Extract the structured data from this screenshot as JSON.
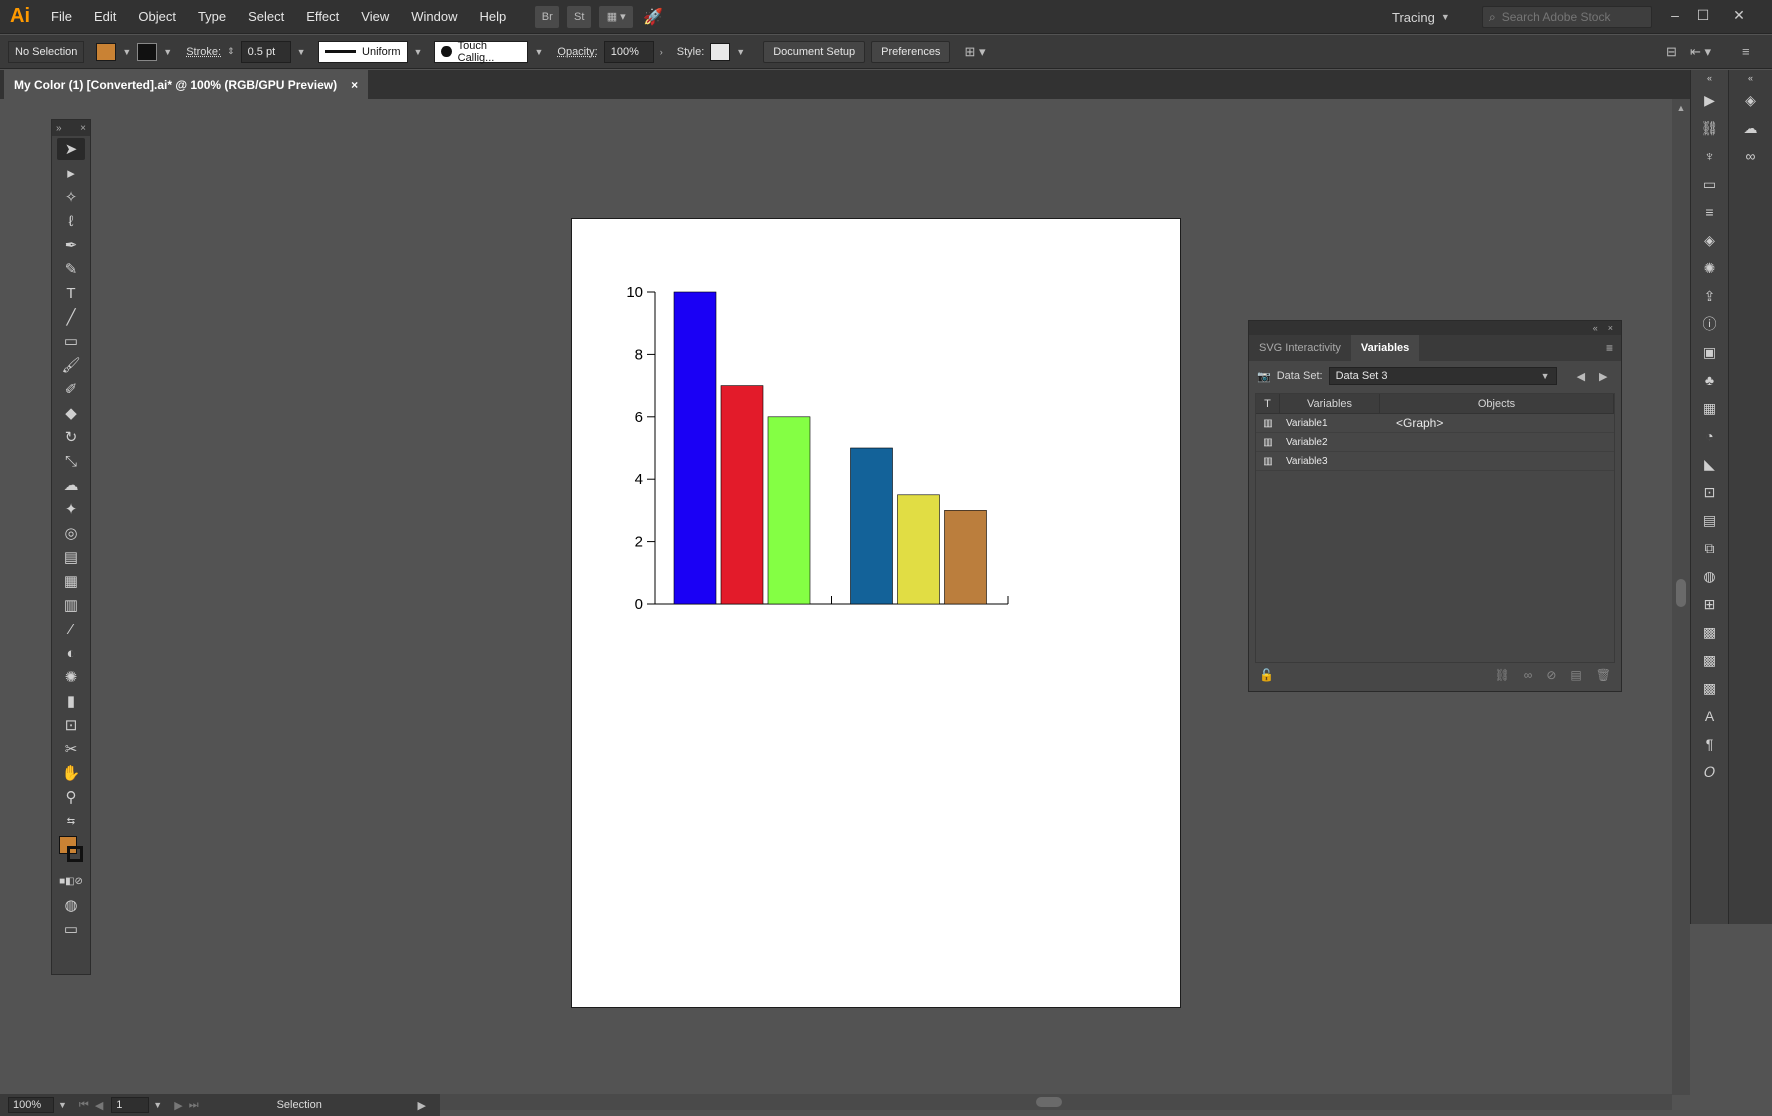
{
  "app": {
    "logo": "Ai"
  },
  "menu": [
    "File",
    "Edit",
    "Object",
    "Type",
    "Select",
    "Effect",
    "View",
    "Window",
    "Help"
  ],
  "menubar_buttons": {
    "bridge": "Br",
    "stock": "St"
  },
  "workspace": "Tracing",
  "search": {
    "placeholder": "Search Adobe Stock"
  },
  "control": {
    "selection": "No Selection",
    "fill_color": "#c98234",
    "stroke_label": "Stroke:",
    "stroke_weight": "0.5 pt",
    "stroke_profile": "Uniform",
    "brush": "Touch Callig...",
    "opacity_label": "Opacity:",
    "opacity": "100%",
    "style_label": "Style:",
    "document_setup": "Document Setup",
    "preferences": "Preferences"
  },
  "document_tab": {
    "title": "My Color (1) [Converted].ai* @ 100% (RGB/GPU Preview)",
    "close": "×"
  },
  "tools": [
    "selection-tool",
    "direct-selection-tool",
    "magic-wand-tool",
    "lasso-tool",
    "pen-tool",
    "curvature-tool",
    "type-tool",
    "line-tool",
    "rectangle-tool",
    "paintbrush-tool",
    "blob-brush-tool",
    "eraser-tool",
    "rotate-tool",
    "scale-tool",
    "warp-tool",
    "puppet-warp-tool",
    "shape-builder-tool",
    "perspective-grid-tool",
    "mesh-tool",
    "gradient-tool",
    "eyedropper-tool",
    "blend-tool",
    "symbol-sprayer-tool",
    "column-graph-tool",
    "artboard-tool",
    "slice-tool",
    "hand-tool",
    "zoom-tool"
  ],
  "chart_data": {
    "type": "bar",
    "categories": [
      "",
      ""
    ],
    "series": [
      {
        "values": [
          10,
          5
        ]
      },
      {
        "values": [
          7,
          3.5
        ]
      },
      {
        "values": [
          6,
          3
        ]
      }
    ],
    "bar_colors": [
      [
        "#1a00f5",
        "#e31b2a",
        "#84ff44"
      ],
      [
        "#136299",
        "#e1dd44",
        "#bb7e3d"
      ]
    ],
    "ylim": [
      0,
      10
    ],
    "yticks": [
      "10",
      "8",
      "6",
      "4",
      "2",
      "0"
    ],
    "grid": false
  },
  "variables_panel": {
    "tabs": [
      "SVG Interactivity",
      "Variables"
    ],
    "active_tab": "Variables",
    "dataset_label": "Data Set:",
    "dataset": "Data Set 3",
    "headers": {
      "type": "T",
      "variables": "Variables",
      "objects": "Objects"
    },
    "rows": [
      {
        "name": "Variable1",
        "object": "<Graph>"
      },
      {
        "name": "Variable2",
        "object": ""
      },
      {
        "name": "Variable3",
        "object": ""
      }
    ]
  },
  "status": {
    "zoom": "100%",
    "artboard": "1",
    "mode": "Selection"
  }
}
